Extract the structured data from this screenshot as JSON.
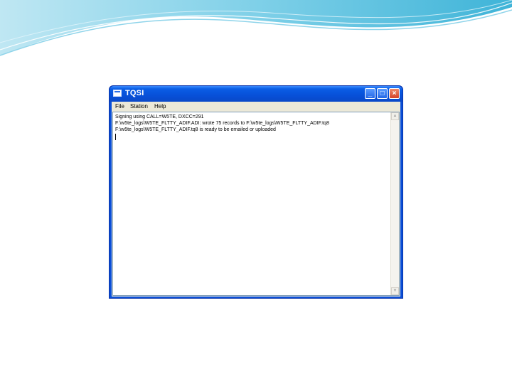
{
  "window": {
    "title": "TQSI",
    "min_glyph": "_",
    "max_glyph": "□",
    "close_glyph": "×"
  },
  "menu": [
    "File",
    "Station",
    "Help"
  ],
  "log_lines": [
    "Signing using CALL=W5TE, DXCC=291",
    "F:\\w5te_logs\\W5TE_FLTTY_ADIF.ADI: wrote 75 records to F:\\w5te_logs\\W5TE_FLTTY_ADIF.tq8",
    "F:\\w5te_logs\\W5TE_FLTTY_ADIF.tq8 is ready to be emailed or uploaded"
  ],
  "scrollbar": {
    "up_glyph": "▲",
    "down_glyph": "▼"
  },
  "colors": {
    "title_bar": "#0b5ee6",
    "frame": "#ece9d8"
  }
}
